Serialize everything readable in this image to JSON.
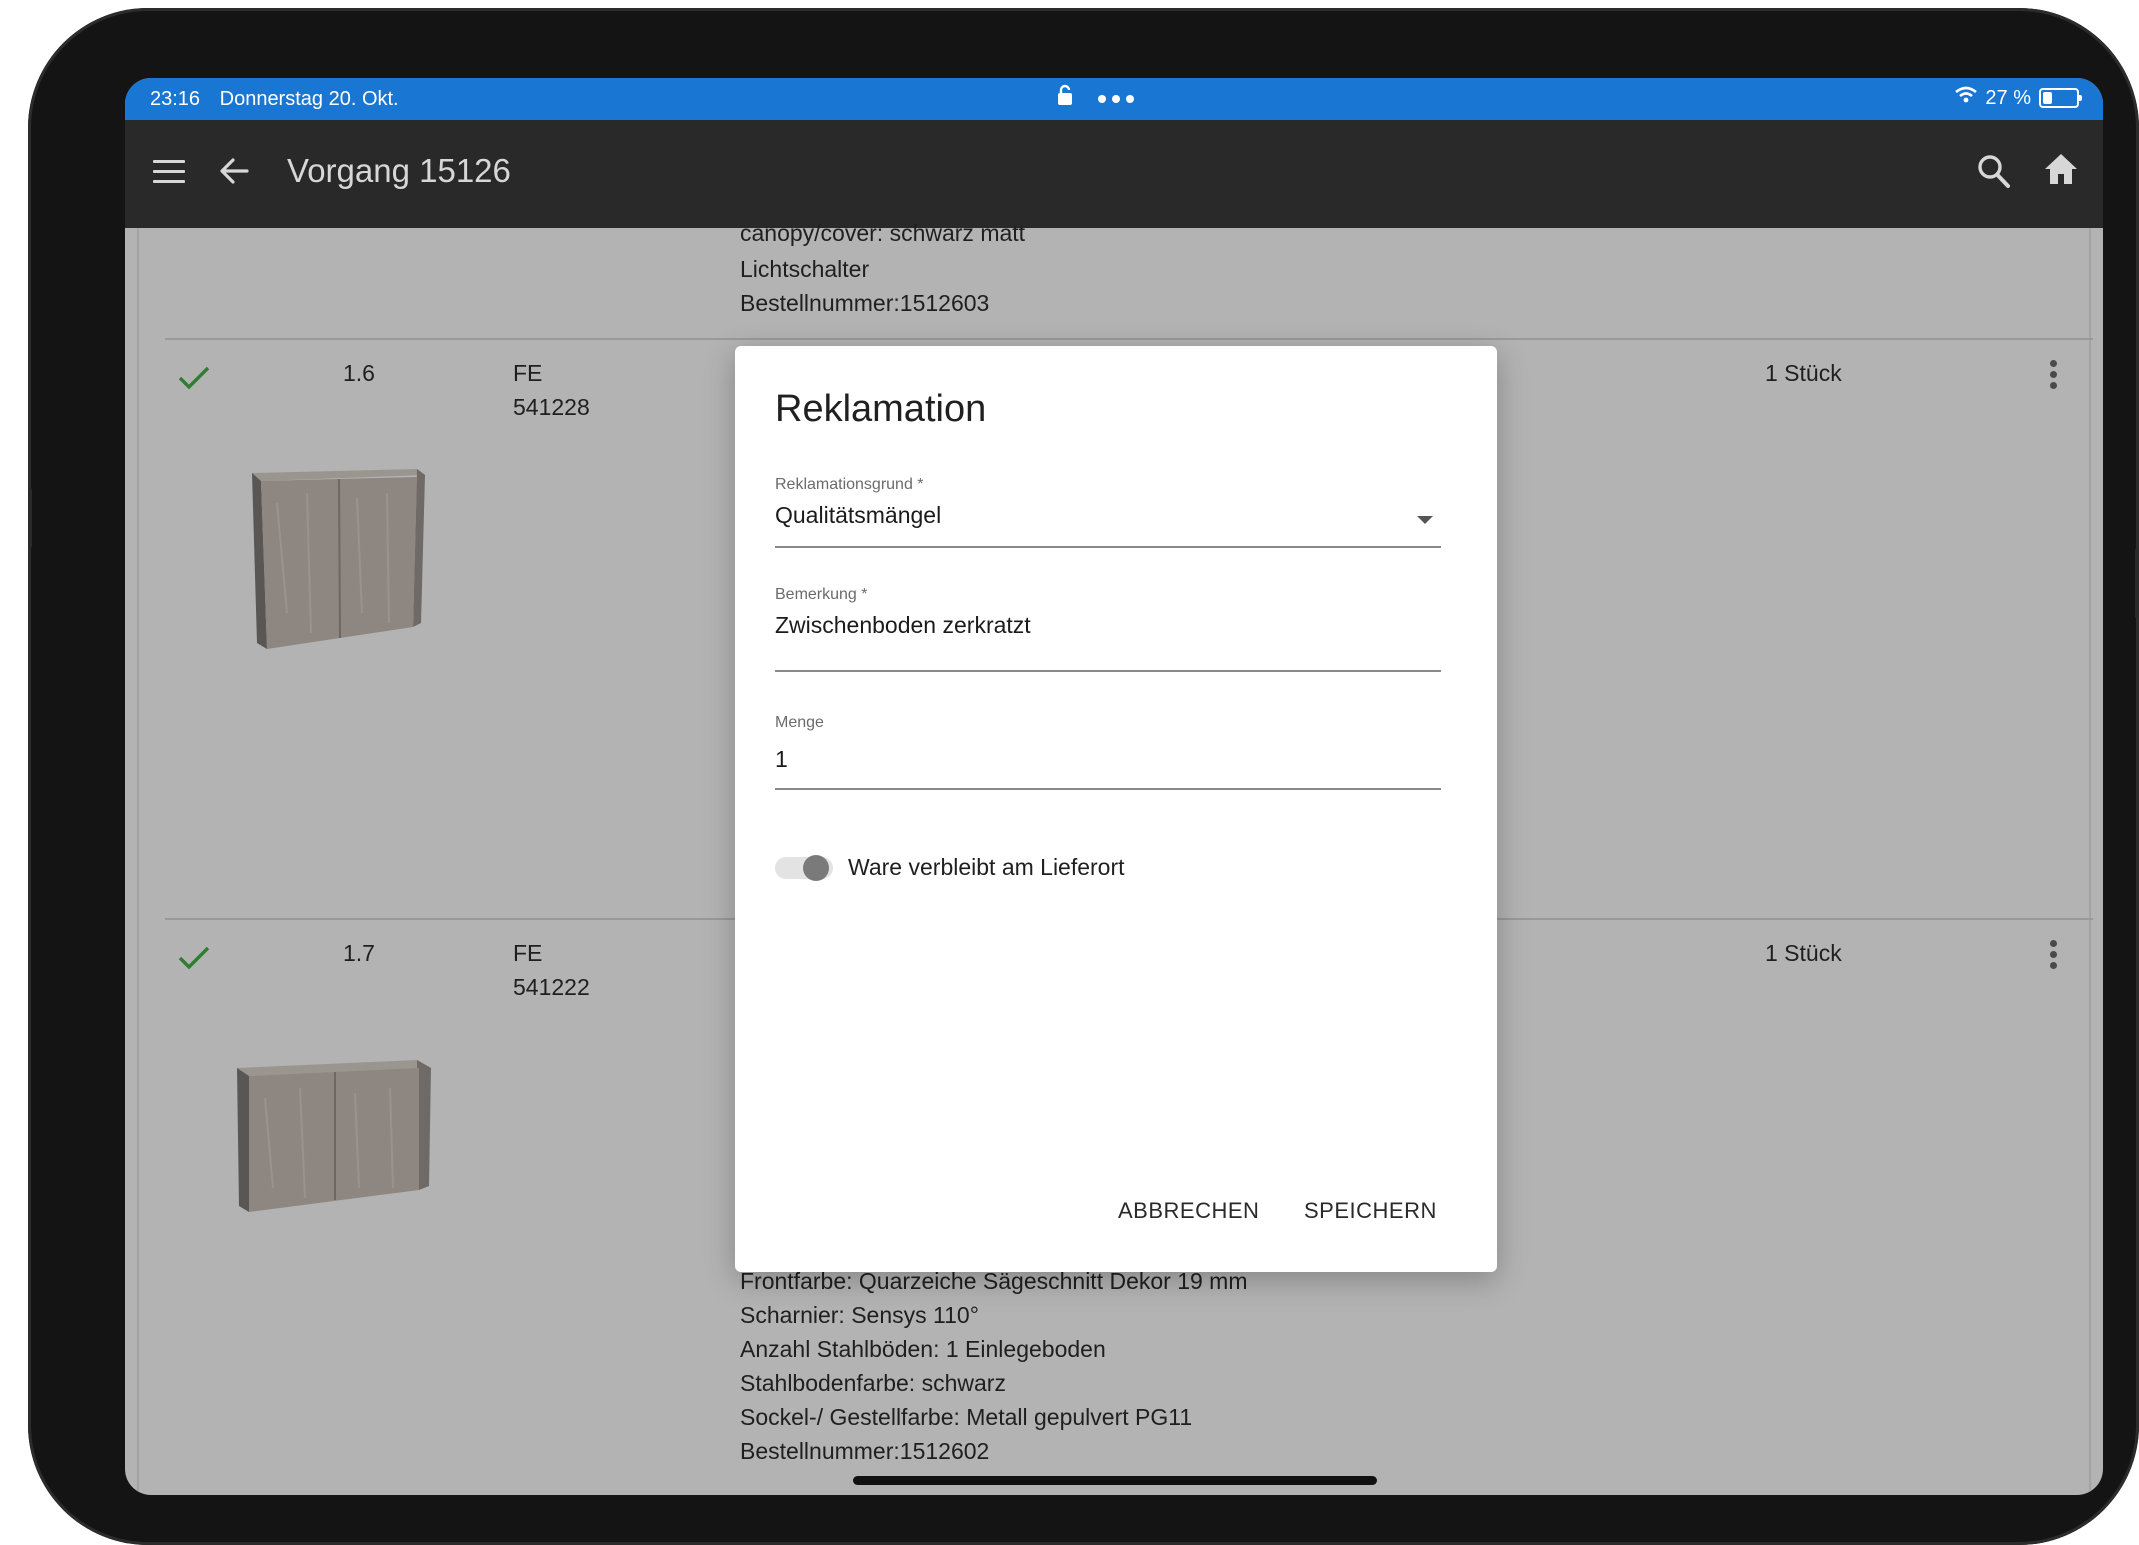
{
  "status_bar": {
    "time": "23:16",
    "date": "Donnerstag 20. Okt.",
    "battery": "27 %",
    "battery_level": 0.27
  },
  "app_bar": {
    "title": "Vorgang 15126",
    "menu_icon": "hamburger-menu-icon",
    "back_icon": "arrow-back-icon",
    "search_icon": "search-icon",
    "home_icon": "home-icon",
    "background": "#292929"
  },
  "partial_item": {
    "lines": [
      "canopy/cover: schwarz matt",
      "Lichtschalter",
      "Bestellnummer:1512603"
    ]
  },
  "items": [
    {
      "checked": true,
      "position": "1.6",
      "supplier": "FE",
      "article_no": "541228",
      "quantity": "1 Stück"
    },
    {
      "checked": true,
      "position": "1.7",
      "supplier": "FE",
      "article_no": "541222",
      "quantity": "1 Stück",
      "details": [
        "Frontfarbe: Quarzeiche Sägeschnitt Dekor 19 mm",
        "Scharnier: Sensys 110°",
        "Anzahl Stahlböden: 1 Einlegeboden",
        "Stahlbodenfarbe: schwarz",
        "Sockel-/ Gestellfarbe: Metall gepulvert PG11",
        "Bestellnummer:1512602"
      ]
    }
  ],
  "dialog": {
    "title": "Reklamation",
    "reason": {
      "label": "Reklamationsgrund *",
      "value": "Qualitätsmängel"
    },
    "remark": {
      "label": "Bemerkung *",
      "value": "Zwischenboden zerkratzt"
    },
    "quantity": {
      "label": "Menge",
      "value": "1"
    },
    "toggle": {
      "label": "Ware verbleibt am Lieferort",
      "on": false
    },
    "cancel_label": "ABBRECHEN",
    "save_label": "SPEICHERN"
  },
  "colors": {
    "status_bar": "#1976d2",
    "check": "#2e7d32",
    "scrim": "#b3b3b3"
  }
}
